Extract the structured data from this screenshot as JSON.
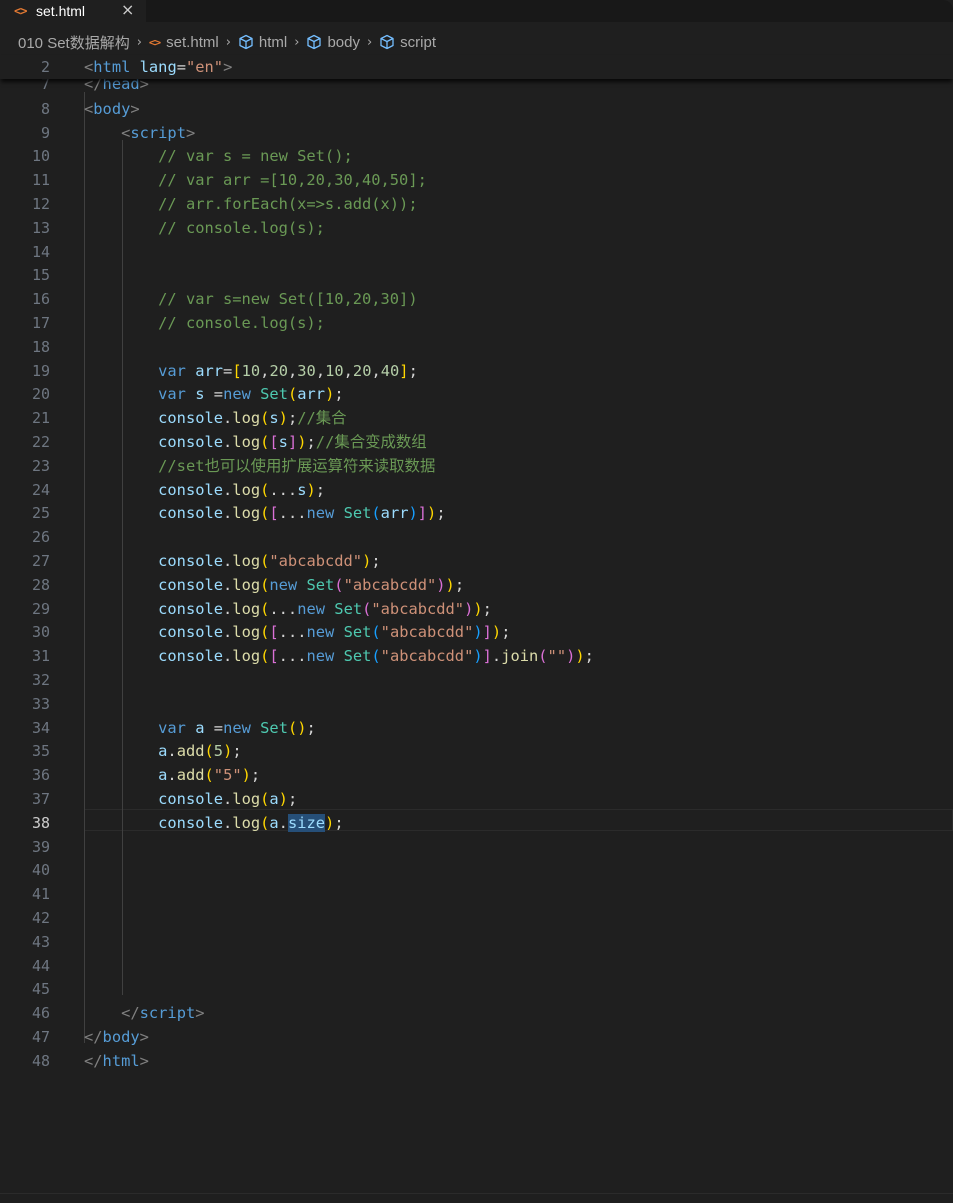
{
  "tab": {
    "label": "set.html",
    "close": "×",
    "icon": "html-file-icon"
  },
  "breadcrumb": {
    "folder": "010 Set数据解构",
    "file": "set.html",
    "items": [
      "html",
      "body",
      "script"
    ]
  },
  "colors": {
    "background": "#1f1f1f",
    "tag": "#569cd6",
    "string": "#ce9178",
    "comment": "#6a9955",
    "variable": "#9cdcfe",
    "class": "#4ec9b0",
    "function": "#dcdcaa",
    "number": "#b5cea8",
    "bracket_gold": "#ffd700",
    "bracket_purple": "#da70d6",
    "bracket_blue": "#179fff"
  },
  "editor": {
    "active_line": "38",
    "lines": [
      {
        "n": "2",
        "tokens": [
          [
            "t-ang",
            "<"
          ],
          [
            "t-tag",
            "html"
          ],
          [
            "t-plain",
            " "
          ],
          [
            "t-attr",
            "lang"
          ],
          [
            "t-plain",
            "="
          ],
          [
            "t-str",
            "\"en\""
          ],
          [
            "t-ang",
            ">"
          ]
        ]
      },
      {
        "n": "7",
        "tokens": [
          [
            "t-ang",
            "</"
          ],
          [
            "t-tag",
            "head"
          ],
          [
            "t-ang",
            ">"
          ]
        ]
      },
      {
        "n": "8",
        "tokens": [
          [
            "t-ang",
            "<"
          ],
          [
            "t-tag",
            "body"
          ],
          [
            "t-ang",
            ">"
          ]
        ]
      },
      {
        "n": "9",
        "tokens": [
          [
            "t-plain",
            "    "
          ],
          [
            "t-ang",
            "<"
          ],
          [
            "t-tag",
            "script"
          ],
          [
            "t-ang",
            ">"
          ]
        ]
      },
      {
        "n": "10",
        "tokens": [
          [
            "t-plain",
            "        "
          ],
          [
            "t-com",
            "// var s = new Set();"
          ]
        ]
      },
      {
        "n": "11",
        "tokens": [
          [
            "t-plain",
            "        "
          ],
          [
            "t-com",
            "// var arr =[10,20,30,40,50];"
          ]
        ]
      },
      {
        "n": "12",
        "tokens": [
          [
            "t-plain",
            "        "
          ],
          [
            "t-com",
            "// arr.forEach(x=>s.add(x));"
          ]
        ]
      },
      {
        "n": "13",
        "tokens": [
          [
            "t-plain",
            "        "
          ],
          [
            "t-com",
            "// console.log(s);"
          ]
        ]
      },
      {
        "n": "14",
        "tokens": []
      },
      {
        "n": "15",
        "tokens": []
      },
      {
        "n": "16",
        "tokens": [
          [
            "t-plain",
            "        "
          ],
          [
            "t-com",
            "// var s=new Set([10,20,30])"
          ]
        ]
      },
      {
        "n": "17",
        "tokens": [
          [
            "t-plain",
            "        "
          ],
          [
            "t-com",
            "// console.log(s);"
          ]
        ]
      },
      {
        "n": "18",
        "tokens": []
      },
      {
        "n": "19",
        "tokens": [
          [
            "t-plain",
            "        "
          ],
          [
            "t-kw",
            "var"
          ],
          [
            "t-plain",
            " "
          ],
          [
            "t-var",
            "arr"
          ],
          [
            "t-plain",
            "="
          ],
          [
            "b1",
            "["
          ],
          [
            "t-num",
            "10"
          ],
          [
            "t-plain",
            ","
          ],
          [
            "t-num",
            "20"
          ],
          [
            "t-plain",
            ","
          ],
          [
            "t-num",
            "30"
          ],
          [
            "t-plain",
            ","
          ],
          [
            "t-num",
            "10"
          ],
          [
            "t-plain",
            ","
          ],
          [
            "t-num",
            "20"
          ],
          [
            "t-plain",
            ","
          ],
          [
            "t-num",
            "40"
          ],
          [
            "b1",
            "]"
          ],
          [
            "t-plain",
            ";"
          ]
        ]
      },
      {
        "n": "20",
        "tokens": [
          [
            "t-plain",
            "        "
          ],
          [
            "t-kw",
            "var"
          ],
          [
            "t-plain",
            " "
          ],
          [
            "t-var",
            "s"
          ],
          [
            "t-plain",
            " ="
          ],
          [
            "t-kw",
            "new"
          ],
          [
            "t-plain",
            " "
          ],
          [
            "t-cls",
            "Set"
          ],
          [
            "b1",
            "("
          ],
          [
            "t-var",
            "arr"
          ],
          [
            "b1",
            ")"
          ],
          [
            "t-plain",
            ";"
          ]
        ]
      },
      {
        "n": "21",
        "tokens": [
          [
            "t-plain",
            "        "
          ],
          [
            "t-var",
            "console"
          ],
          [
            "t-plain",
            "."
          ],
          [
            "t-fn",
            "log"
          ],
          [
            "b1",
            "("
          ],
          [
            "t-var",
            "s"
          ],
          [
            "b1",
            ")"
          ],
          [
            "t-plain",
            ";"
          ],
          [
            "t-com",
            "//集合"
          ]
        ]
      },
      {
        "n": "22",
        "tokens": [
          [
            "t-plain",
            "        "
          ],
          [
            "t-var",
            "console"
          ],
          [
            "t-plain",
            "."
          ],
          [
            "t-fn",
            "log"
          ],
          [
            "b1",
            "("
          ],
          [
            "b2",
            "["
          ],
          [
            "t-var",
            "s"
          ],
          [
            "b2",
            "]"
          ],
          [
            "b1",
            ")"
          ],
          [
            "t-plain",
            ";"
          ],
          [
            "t-com",
            "//集合变成数组"
          ]
        ]
      },
      {
        "n": "23",
        "tokens": [
          [
            "t-plain",
            "        "
          ],
          [
            "t-com",
            "//set也可以使用扩展运算符来读取数据"
          ]
        ]
      },
      {
        "n": "24",
        "tokens": [
          [
            "t-plain",
            "        "
          ],
          [
            "t-var",
            "console"
          ],
          [
            "t-plain",
            "."
          ],
          [
            "t-fn",
            "log"
          ],
          [
            "b1",
            "("
          ],
          [
            "t-plain",
            "..."
          ],
          [
            "t-var",
            "s"
          ],
          [
            "b1",
            ")"
          ],
          [
            "t-plain",
            ";"
          ]
        ]
      },
      {
        "n": "25",
        "tokens": [
          [
            "t-plain",
            "        "
          ],
          [
            "t-var",
            "console"
          ],
          [
            "t-plain",
            "."
          ],
          [
            "t-fn",
            "log"
          ],
          [
            "b1",
            "("
          ],
          [
            "b2",
            "["
          ],
          [
            "t-plain",
            "..."
          ],
          [
            "t-kw",
            "new"
          ],
          [
            "t-plain",
            " "
          ],
          [
            "t-cls",
            "Set"
          ],
          [
            "b3",
            "("
          ],
          [
            "t-var",
            "arr"
          ],
          [
            "b3",
            ")"
          ],
          [
            "b2",
            "]"
          ],
          [
            "b1",
            ")"
          ],
          [
            "t-plain",
            ";"
          ]
        ]
      },
      {
        "n": "26",
        "tokens": []
      },
      {
        "n": "27",
        "tokens": [
          [
            "t-plain",
            "        "
          ],
          [
            "t-var",
            "console"
          ],
          [
            "t-plain",
            "."
          ],
          [
            "t-fn",
            "log"
          ],
          [
            "b1",
            "("
          ],
          [
            "t-str",
            "\"abcabcdd\""
          ],
          [
            "b1",
            ")"
          ],
          [
            "t-plain",
            ";"
          ]
        ]
      },
      {
        "n": "28",
        "tokens": [
          [
            "t-plain",
            "        "
          ],
          [
            "t-var",
            "console"
          ],
          [
            "t-plain",
            "."
          ],
          [
            "t-fn",
            "log"
          ],
          [
            "b1",
            "("
          ],
          [
            "t-kw",
            "new"
          ],
          [
            "t-plain",
            " "
          ],
          [
            "t-cls",
            "Set"
          ],
          [
            "b2",
            "("
          ],
          [
            "t-str",
            "\"abcabcdd\""
          ],
          [
            "b2",
            ")"
          ],
          [
            "b1",
            ")"
          ],
          [
            "t-plain",
            ";"
          ]
        ]
      },
      {
        "n": "29",
        "tokens": [
          [
            "t-plain",
            "        "
          ],
          [
            "t-var",
            "console"
          ],
          [
            "t-plain",
            "."
          ],
          [
            "t-fn",
            "log"
          ],
          [
            "b1",
            "("
          ],
          [
            "t-plain",
            "..."
          ],
          [
            "t-kw",
            "new"
          ],
          [
            "t-plain",
            " "
          ],
          [
            "t-cls",
            "Set"
          ],
          [
            "b2",
            "("
          ],
          [
            "t-str",
            "\"abcabcdd\""
          ],
          [
            "b2",
            ")"
          ],
          [
            "b1",
            ")"
          ],
          [
            "t-plain",
            ";"
          ]
        ]
      },
      {
        "n": "30",
        "tokens": [
          [
            "t-plain",
            "        "
          ],
          [
            "t-var",
            "console"
          ],
          [
            "t-plain",
            "."
          ],
          [
            "t-fn",
            "log"
          ],
          [
            "b1",
            "("
          ],
          [
            "b2",
            "["
          ],
          [
            "t-plain",
            "..."
          ],
          [
            "t-kw",
            "new"
          ],
          [
            "t-plain",
            " "
          ],
          [
            "t-cls",
            "Set"
          ],
          [
            "b3",
            "("
          ],
          [
            "t-str",
            "\"abcabcdd\""
          ],
          [
            "b3",
            ")"
          ],
          [
            "b2",
            "]"
          ],
          [
            "b1",
            ")"
          ],
          [
            "t-plain",
            ";"
          ]
        ]
      },
      {
        "n": "31",
        "tokens": [
          [
            "t-plain",
            "        "
          ],
          [
            "t-var",
            "console"
          ],
          [
            "t-plain",
            "."
          ],
          [
            "t-fn",
            "log"
          ],
          [
            "b1",
            "("
          ],
          [
            "b2",
            "["
          ],
          [
            "t-plain",
            "..."
          ],
          [
            "t-kw",
            "new"
          ],
          [
            "t-plain",
            " "
          ],
          [
            "t-cls",
            "Set"
          ],
          [
            "b3",
            "("
          ],
          [
            "t-str",
            "\"abcabcdd\""
          ],
          [
            "b3",
            ")"
          ],
          [
            "b2",
            "]"
          ],
          [
            "t-plain",
            "."
          ],
          [
            "t-fn",
            "join"
          ],
          [
            "b2",
            "("
          ],
          [
            "t-str",
            "\"\""
          ],
          [
            "b2",
            ")"
          ],
          [
            "b1",
            ")"
          ],
          [
            "t-plain",
            ";"
          ]
        ]
      },
      {
        "n": "32",
        "tokens": []
      },
      {
        "n": "33",
        "tokens": []
      },
      {
        "n": "34",
        "tokens": [
          [
            "t-plain",
            "        "
          ],
          [
            "t-kw",
            "var"
          ],
          [
            "t-plain",
            " "
          ],
          [
            "t-var",
            "a"
          ],
          [
            "t-plain",
            " ="
          ],
          [
            "t-kw",
            "new"
          ],
          [
            "t-plain",
            " "
          ],
          [
            "t-cls",
            "Set"
          ],
          [
            "b1",
            "()"
          ],
          [
            "t-plain",
            ";"
          ]
        ]
      },
      {
        "n": "35",
        "tokens": [
          [
            "t-plain",
            "        "
          ],
          [
            "t-var",
            "a"
          ],
          [
            "t-plain",
            "."
          ],
          [
            "t-fn",
            "add"
          ],
          [
            "b1",
            "("
          ],
          [
            "t-num",
            "5"
          ],
          [
            "b1",
            ")"
          ],
          [
            "t-plain",
            ";"
          ]
        ]
      },
      {
        "n": "36",
        "tokens": [
          [
            "t-plain",
            "        "
          ],
          [
            "t-var",
            "a"
          ],
          [
            "t-plain",
            "."
          ],
          [
            "t-fn",
            "add"
          ],
          [
            "b1",
            "("
          ],
          [
            "t-str",
            "\"5\""
          ],
          [
            "b1",
            ")"
          ],
          [
            "t-plain",
            ";"
          ]
        ]
      },
      {
        "n": "37",
        "tokens": [
          [
            "t-plain",
            "        "
          ],
          [
            "t-var",
            "console"
          ],
          [
            "t-plain",
            "."
          ],
          [
            "t-fn",
            "log"
          ],
          [
            "b1",
            "("
          ],
          [
            "t-var",
            "a"
          ],
          [
            "b1",
            ")"
          ],
          [
            "t-plain",
            ";"
          ]
        ]
      },
      {
        "n": "38",
        "tokens": [
          [
            "t-plain",
            "        "
          ],
          [
            "t-var",
            "console"
          ],
          [
            "t-plain",
            "."
          ],
          [
            "t-fn",
            "log"
          ],
          [
            "b1",
            "("
          ],
          [
            "t-var",
            "a"
          ],
          [
            "t-plain",
            "."
          ],
          [
            "select-bg",
            "size"
          ],
          [
            "b1",
            ")"
          ],
          [
            "t-plain",
            ";"
          ]
        ]
      },
      {
        "n": "39",
        "tokens": []
      },
      {
        "n": "40",
        "tokens": []
      },
      {
        "n": "41",
        "tokens": []
      },
      {
        "n": "42",
        "tokens": []
      },
      {
        "n": "43",
        "tokens": []
      },
      {
        "n": "44",
        "tokens": []
      },
      {
        "n": "45",
        "tokens": []
      },
      {
        "n": "46",
        "tokens": [
          [
            "t-plain",
            "    "
          ],
          [
            "t-ang",
            "</"
          ],
          [
            "t-tag",
            "script"
          ],
          [
            "t-ang",
            ">"
          ]
        ]
      },
      {
        "n": "47",
        "tokens": [
          [
            "t-ang",
            "</"
          ],
          [
            "t-tag",
            "body"
          ],
          [
            "t-ang",
            ">"
          ]
        ]
      },
      {
        "n": "48",
        "tokens": [
          [
            "t-ang",
            "</"
          ],
          [
            "t-tag",
            "html"
          ],
          [
            "t-ang",
            ">"
          ]
        ]
      }
    ]
  }
}
